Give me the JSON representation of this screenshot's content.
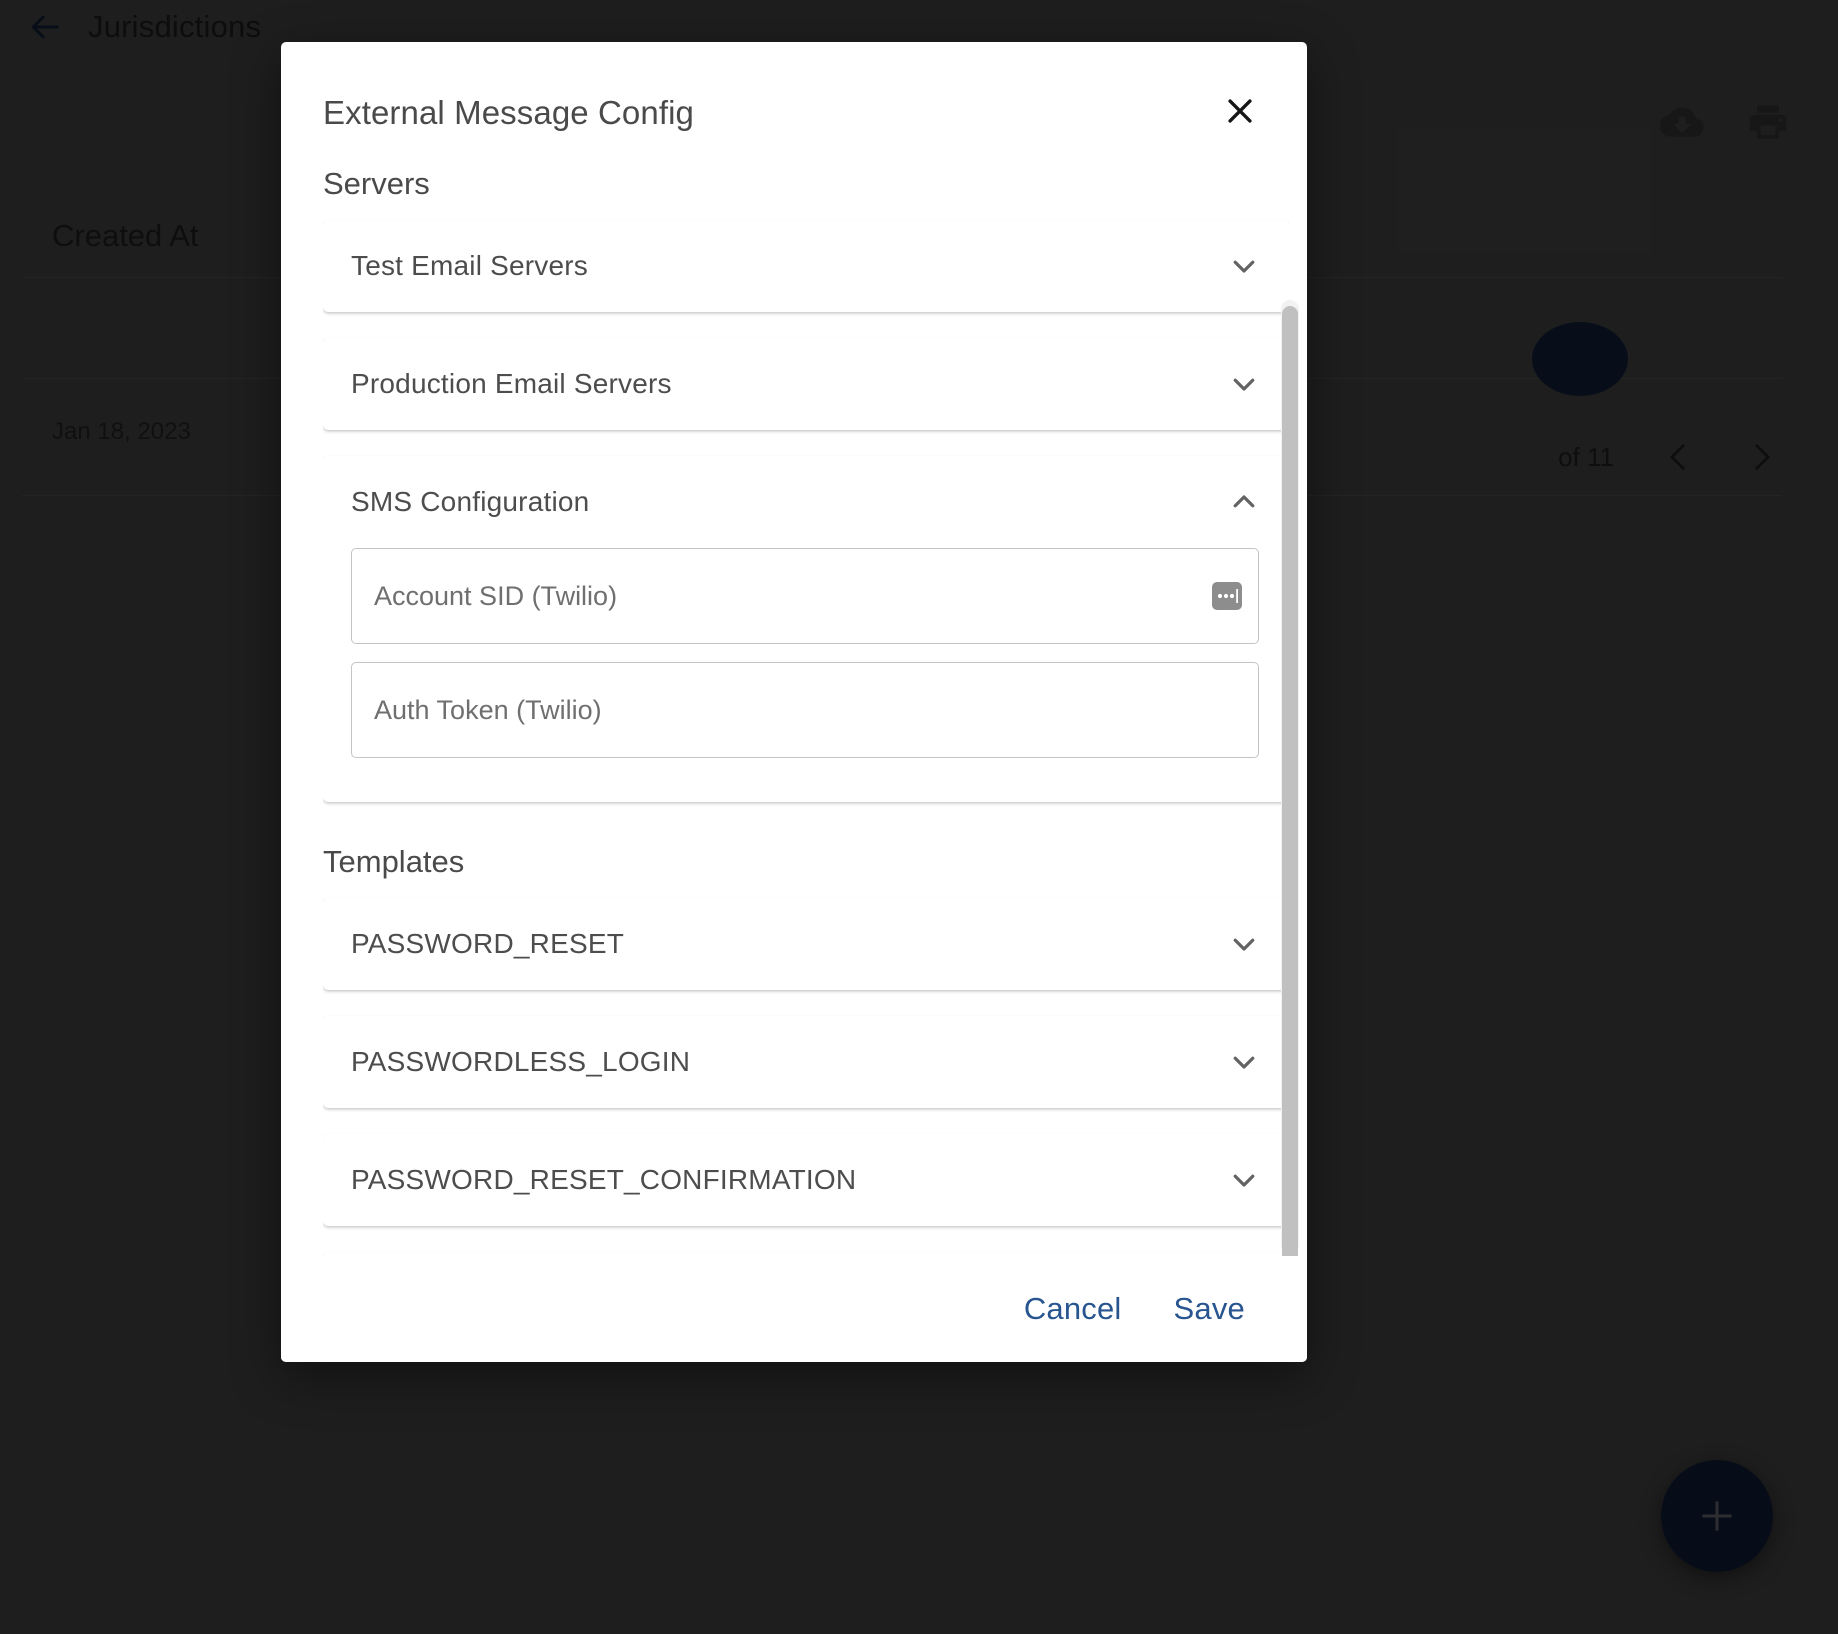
{
  "background": {
    "back_icon": "arrow-left-icon",
    "page_title": "Jurisdictions",
    "toolbar_icons": [
      "cloud-download-icon",
      "print-icon"
    ],
    "table": {
      "column_header": "Created At",
      "cell_value": "Jan 18, 2023"
    },
    "pagination": {
      "range_text": "of 11",
      "prev_icon": "chevron-left-icon",
      "next_icon": "chevron-right-icon"
    },
    "fab": {
      "icon": "plus-icon",
      "color": "#0e1a2e"
    }
  },
  "dialog": {
    "title": "External Message Config",
    "close_icon": "close-icon",
    "sections": {
      "servers_label": "Servers",
      "templates_label": "Templates"
    },
    "server_panels": [
      {
        "label": "Test Email Servers",
        "expanded": false,
        "chevron": "chevron-down-icon"
      },
      {
        "label": "Production Email Servers",
        "expanded": false,
        "chevron": "chevron-down-icon"
      },
      {
        "label": "SMS Configuration",
        "expanded": true,
        "chevron": "chevron-up-icon"
      }
    ],
    "sms_fields": [
      {
        "placeholder": "Account SID (Twilio)",
        "value": "",
        "autofill_icon": "autofill-icon"
      },
      {
        "placeholder": "Auth Token (Twilio)",
        "value": ""
      }
    ],
    "template_panels": [
      {
        "label": "PASSWORD_RESET",
        "chevron": "chevron-down-icon"
      },
      {
        "label": "PASSWORDLESS_LOGIN",
        "chevron": "chevron-down-icon"
      },
      {
        "label": "PASSWORD_RESET_CONFIRMATION",
        "chevron": "chevron-down-icon"
      }
    ],
    "footer": {
      "cancel_label": "Cancel",
      "save_label": "Save",
      "action_color": "#28558f"
    }
  }
}
